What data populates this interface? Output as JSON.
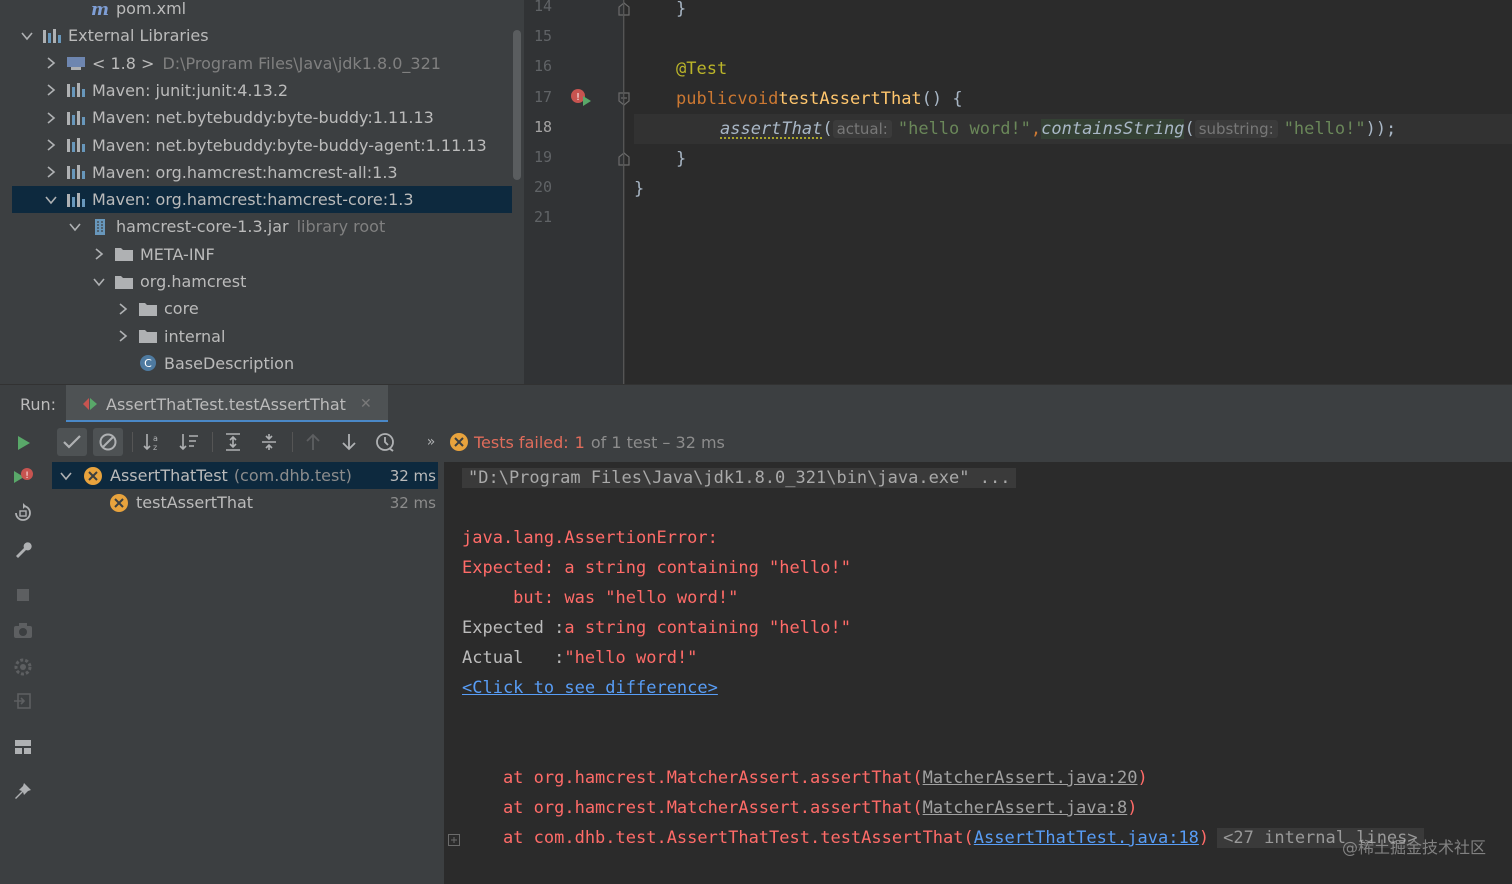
{
  "project_tree": {
    "items": [
      {
        "label": "pom.xml",
        "muted": "",
        "icon": "maven-file-icon",
        "level": 2,
        "arrow": ""
      },
      {
        "label": "External Libraries",
        "muted": "",
        "icon": "library-icon",
        "level": 0,
        "arrow": "down"
      },
      {
        "label": "< 1.8 >",
        "muted": "D:\\Program Files\\Java\\jdk1.8.0_321",
        "icon": "jdk-icon",
        "level": 1,
        "arrow": "right"
      },
      {
        "label": "Maven: junit:junit:4.13.2",
        "muted": "",
        "icon": "library-icon",
        "level": 1,
        "arrow": "right"
      },
      {
        "label": "Maven: net.bytebuddy:byte-buddy:1.11.13",
        "muted": "",
        "icon": "library-icon",
        "level": 1,
        "arrow": "right"
      },
      {
        "label": "Maven: net.bytebuddy:byte-buddy-agent:1.11.13",
        "muted": "",
        "icon": "library-icon",
        "level": 1,
        "arrow": "right"
      },
      {
        "label": "Maven: org.hamcrest:hamcrest-all:1.3",
        "muted": "",
        "icon": "library-icon",
        "level": 1,
        "arrow": "right"
      },
      {
        "label": "Maven: org.hamcrest:hamcrest-core:1.3",
        "muted": "",
        "icon": "library-icon",
        "level": 1,
        "arrow": "down",
        "selected": true
      },
      {
        "label": "hamcrest-core-1.3.jar",
        "muted": "library root",
        "icon": "jar-icon",
        "level": 2,
        "arrow": "down"
      },
      {
        "label": "META-INF",
        "muted": "",
        "icon": "folder-icon",
        "level": 3,
        "arrow": "right"
      },
      {
        "label": "org.hamcrest",
        "muted": "",
        "icon": "folder-icon",
        "level": 3,
        "arrow": "down"
      },
      {
        "label": "core",
        "muted": "",
        "icon": "folder-icon",
        "level": 4,
        "arrow": "right"
      },
      {
        "label": "internal",
        "muted": "",
        "icon": "folder-icon",
        "level": 4,
        "arrow": "right"
      },
      {
        "label": "BaseDescription",
        "muted": "",
        "icon": "class-icon",
        "level": 4,
        "arrow": ""
      }
    ]
  },
  "editor": {
    "line_numbers": [
      "14",
      "15",
      "16",
      "17",
      "18",
      "19",
      "20",
      "21"
    ],
    "current_line": "18",
    "code": {
      "l14": "}",
      "l16_annotation": "@Test",
      "l17_public": "public",
      "l17_void": "void",
      "l17_name": "testAssertThat",
      "l17_rest": "() {",
      "l18_call": "assertThat",
      "l18_paren": "(",
      "l18_hint1": "actual:",
      "l18_str1": "\"hello word!\"",
      "l18_comma": ",",
      "l18_call2": "containsString",
      "l18_paren2": "(",
      "l18_hint2": "substring:",
      "l18_str2": "\"hello!\"",
      "l18_end": "));",
      "l19": "}",
      "l20": "}"
    }
  },
  "run_panel": {
    "label": "Run:",
    "tab_title": "AssertThatTest.testAssertThat",
    "status_failed": "Tests failed:",
    "status_count": "1",
    "status_rest": "of 1 test – 32 ms",
    "more": "»",
    "test_tree": [
      {
        "name": "AssertThatTest",
        "pkg": "(com.dhb.test)",
        "time": "32 ms",
        "selected": true,
        "arrow": "down"
      },
      {
        "name": "testAssertThat",
        "pkg": "",
        "time": "32 ms",
        "selected": false,
        "arrow": ""
      }
    ]
  },
  "console": {
    "cmd": "\"D:\\Program Files\\Java\\jdk1.8.0_321\\bin\\java.exe\" ...",
    "error_type": "java.lang.AssertionError:",
    "expected_line": "Expected: a string containing \"hello!\"",
    "but_line": "     but: was \"hello word!\"",
    "expected2_label": "Expected :",
    "expected2_value": "a string containing \"hello!\"",
    "actual_label": "Actual   :",
    "actual_value": "\"hello word!\"",
    "diff_link": "<Click to see difference>",
    "stack": [
      {
        "prefix": "    at org.hamcrest.MatcherAssert.assertThat(",
        "link": "MatcherAssert.java:20",
        "suffix": ")"
      },
      {
        "prefix": "    at org.hamcrest.MatcherAssert.assertThat(",
        "link": "MatcherAssert.java:8",
        "suffix": ")"
      },
      {
        "prefix": "    at com.dhb.test.AssertThatTest.testAssertThat(",
        "link": "AssertThatTest.java:18",
        "suffix": ")"
      }
    ],
    "internal_lines": "<27 internal lines>",
    "watermark": "@稀土掘金技术社区"
  },
  "colors": {
    "background": "#2b2b2b",
    "panel": "#3c3f41",
    "selection": "#0d293e",
    "error_red": "#ff6b68",
    "run_green": "#59a869",
    "link_blue": "#589df6"
  }
}
